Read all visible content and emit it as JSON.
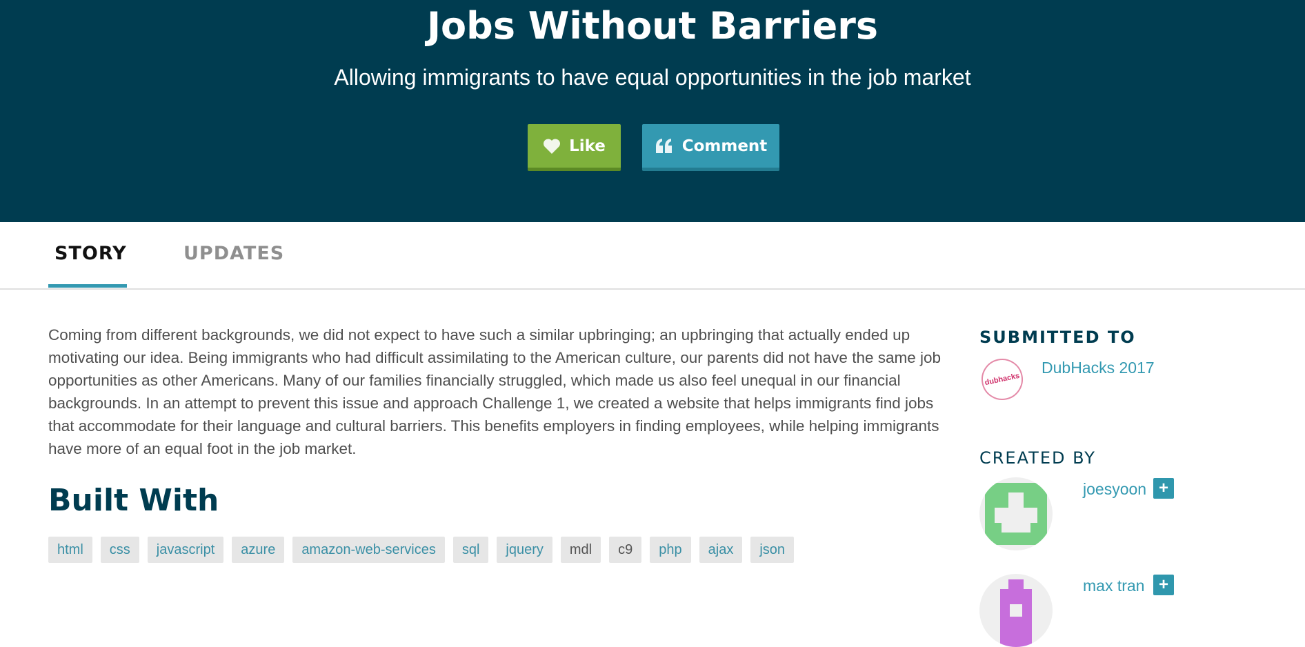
{
  "hero": {
    "title": "Jobs Without Barriers",
    "subtitle": "Allowing immigrants to have equal opportunities in the job market",
    "like_label": "Like",
    "comment_label": "Comment",
    "bg_color": "#003c50",
    "like_color": "#7fb13c",
    "comment_color": "#3399b1"
  },
  "tabs": [
    {
      "label": "STORY",
      "active": true
    },
    {
      "label": "UPDATES",
      "active": false
    }
  ],
  "story": {
    "text": "Coming from different backgrounds, we did not expect to have such a similar upbringing; an upbringing that actually ended up motivating our idea. Being immigrants who had difficult assimilating to the American culture, our parents did not have the same job opportunities as other Americans. Many of our families financially struggled, which made us also feel unequal in our financial backgrounds. In an attempt to prevent this issue and approach Challenge 1, we created a website that helps immigrants find jobs that accommodate for their language and cultural barriers. This benefits employers in finding employees, while helping immigrants have more of an equal foot in the job market."
  },
  "built_with": {
    "heading": "Built With",
    "tags": [
      "html",
      "css",
      "javascript",
      "azure",
      "amazon-web-services",
      "sql",
      "jquery",
      "mdl",
      "c9",
      "php",
      "ajax",
      "json"
    ]
  },
  "sidebar": {
    "submitted_heading": "SUBMITTED TO",
    "hackathon_logo_text": "dubhacks",
    "hackathon_name": "DubHacks 2017",
    "created_heading": "CREATED BY",
    "creators": [
      {
        "name": "joesyoon",
        "follow_icon": "+",
        "avatar_color": "#77cf85"
      },
      {
        "name": "max tran",
        "follow_icon": "+",
        "avatar_color": "#c76edc"
      }
    ]
  },
  "icons": {
    "like": "heart-icon",
    "comment": "quote-icon",
    "follow": "plus-icon"
  }
}
